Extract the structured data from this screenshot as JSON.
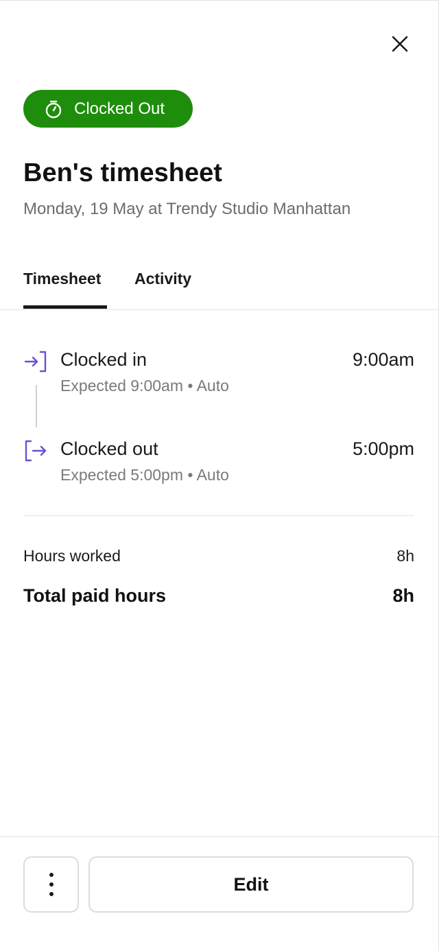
{
  "status": {
    "label": "Clocked Out",
    "icon": "stopwatch-icon",
    "color": "#1f8d0c"
  },
  "header": {
    "title": "Ben's timesheet",
    "subtitle": "Monday, 19 May at Trendy Studio Manhattan"
  },
  "tabs": [
    {
      "label": "Timesheet",
      "active": true
    },
    {
      "label": "Activity",
      "active": false
    }
  ],
  "events": [
    {
      "label": "Clocked in",
      "time": "9:00am",
      "sub": "Expected 9:00am • Auto",
      "icon": "clock-in-icon"
    },
    {
      "label": "Clocked out",
      "time": "5:00pm",
      "sub": "Expected 5:00pm • Auto",
      "icon": "clock-out-icon"
    }
  ],
  "summary": {
    "hours_worked_label": "Hours worked",
    "hours_worked_value": "8h",
    "total_paid_label": "Total paid hours",
    "total_paid_value": "8h"
  },
  "footer": {
    "more_icon": "more-vertical-icon",
    "edit_label": "Edit"
  },
  "colors": {
    "accent": "#6b4fd0",
    "status_green": "#1f8d0c"
  }
}
